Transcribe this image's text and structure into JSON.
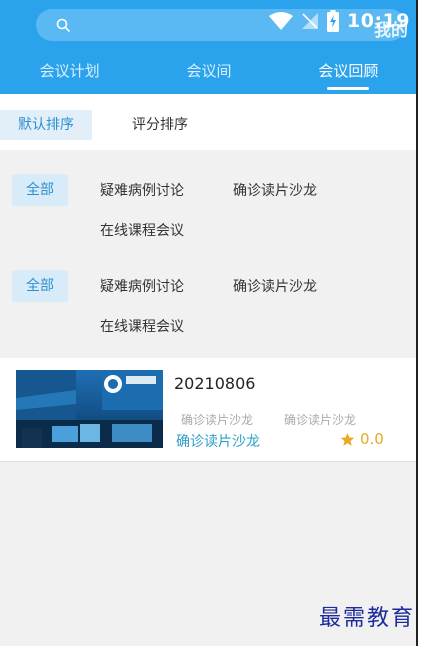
{
  "status_bar": {
    "time": "10:19"
  },
  "header": {
    "mine_label": "我的"
  },
  "tabs": [
    {
      "label": "会议计划"
    },
    {
      "label": "会议间"
    },
    {
      "label": "会议回顾"
    }
  ],
  "sort": {
    "default_label": "默认排序",
    "score_label": "评分排序"
  },
  "filters": [
    {
      "all": "全部",
      "items": [
        "疑难病例讨论",
        "确诊读片沙龙",
        "在线课程会议"
      ]
    },
    {
      "all": "全部",
      "items": [
        "疑难病例讨论",
        "确诊读片沙龙",
        "在线课程会议"
      ]
    }
  ],
  "meeting": {
    "title": "20210806",
    "tags": [
      "确诊读片沙龙",
      "确诊读片沙龙"
    ],
    "category": "确诊读片沙龙",
    "rating": "0.0"
  },
  "watermark": "最需教育",
  "colors": {
    "header_bg": "#2aa3ec",
    "accent": "#2f8fcf",
    "star": "#e9a923"
  }
}
